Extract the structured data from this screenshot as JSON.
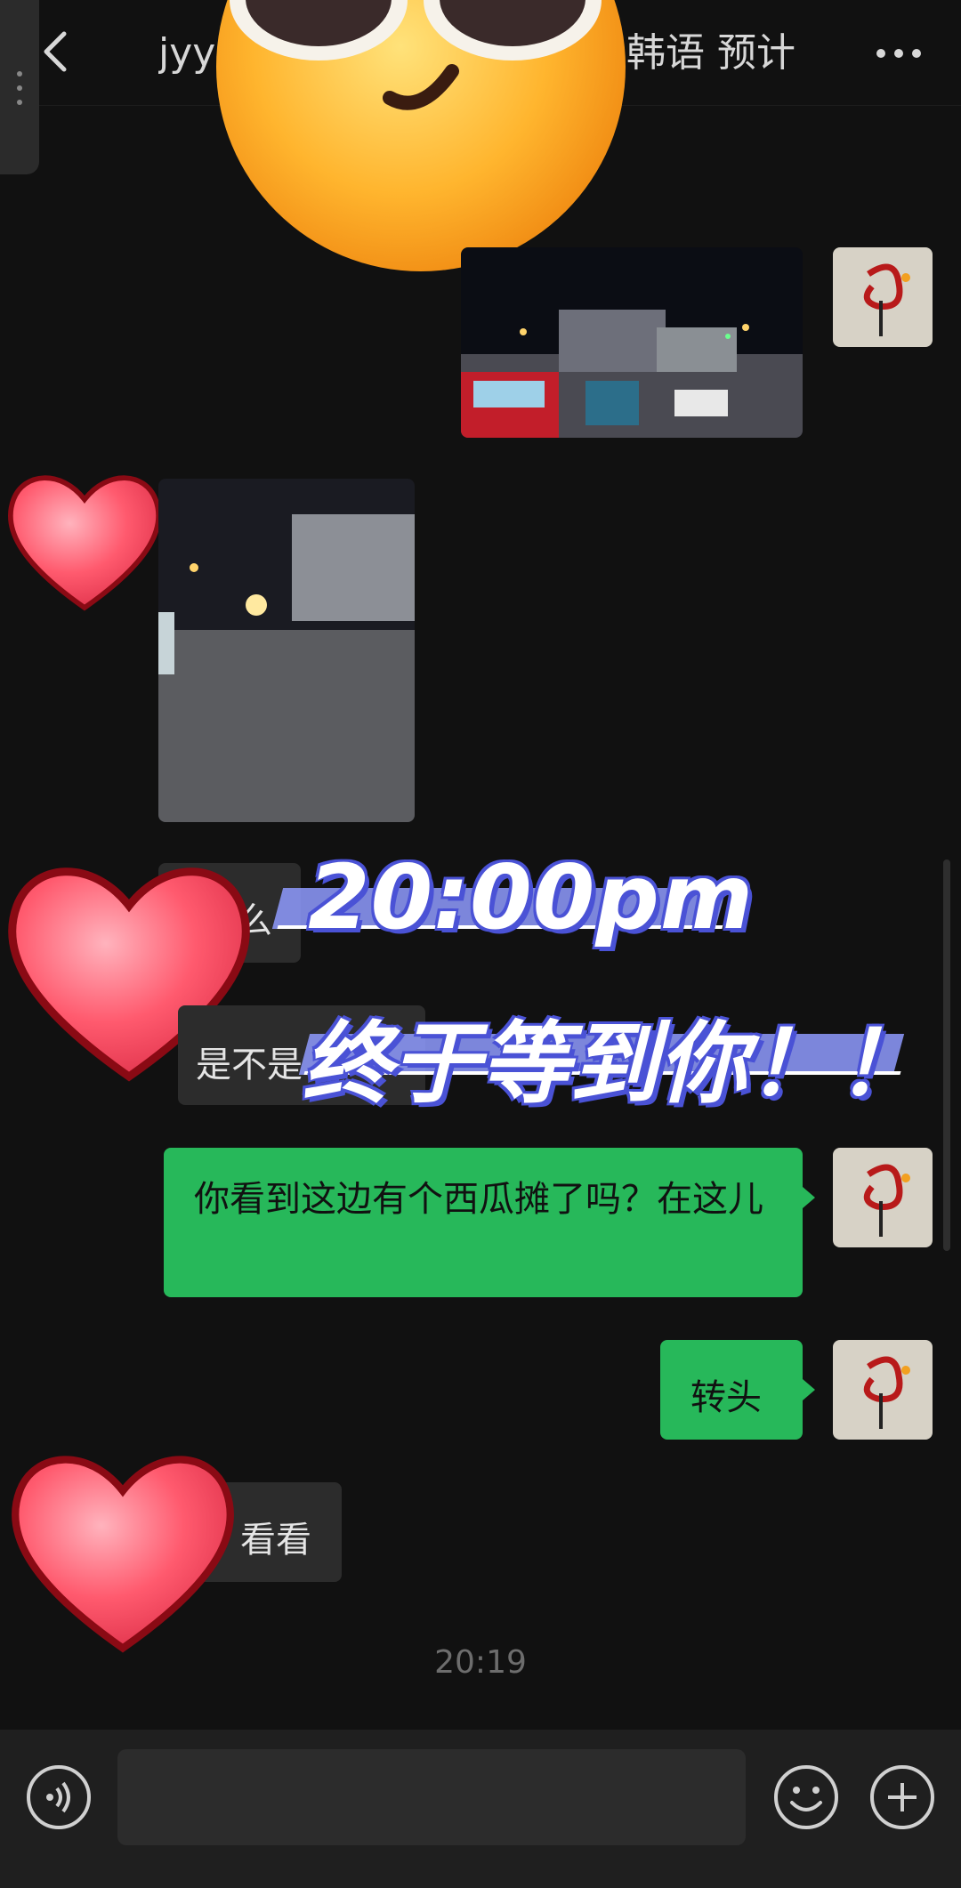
{
  "header": {
    "title": "jyy",
    "title_right": "韩语 预计"
  },
  "messages": {
    "partial_in_1": "么",
    "partial_in_2": "是不是",
    "out_watermelon": "你看到这边有个西瓜摊了吗？在这儿",
    "out_turn": "转头",
    "partial_in_3": "看看"
  },
  "timestamp": "20:19",
  "overlay": {
    "line1": "20:00pm",
    "line2": "终于等到你！！"
  },
  "icons": [
    "chevron-left-icon",
    "more-icon",
    "voice-icon",
    "emoji-icon",
    "plus-icon",
    "sunglasses-emoji-sticker",
    "heart-sticker"
  ],
  "colors": {
    "outgoing_bubble": "#27b85a",
    "incoming_bubble": "#2c2c2c",
    "background": "#111111",
    "overlay_accent": "#8f9bff"
  }
}
